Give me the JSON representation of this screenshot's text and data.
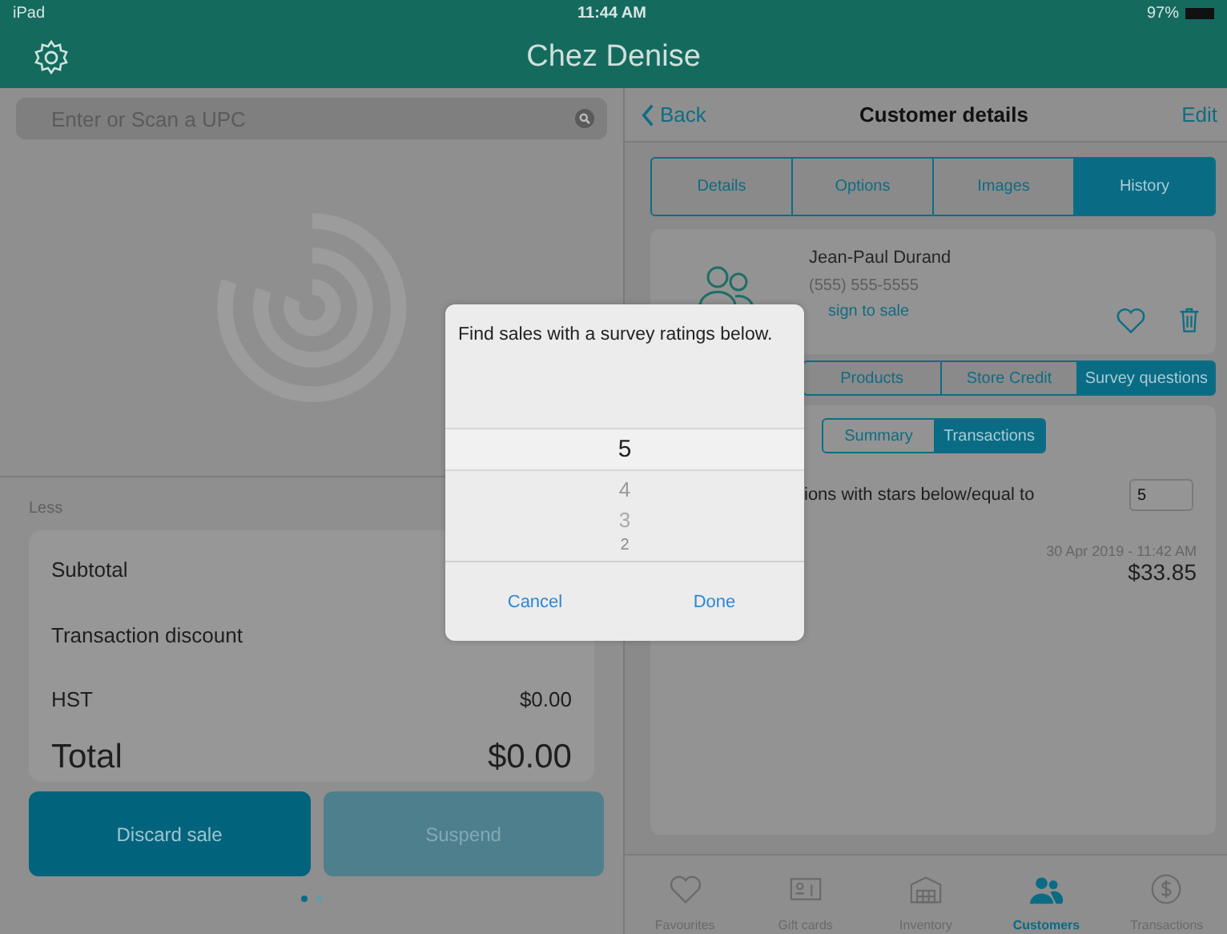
{
  "status_bar": {
    "carrier": "iPad",
    "time": "11:44 AM",
    "battery": "97%"
  },
  "header": {
    "title": "Chez Denise"
  },
  "search": {
    "placeholder": "Enter or Scan a UPC"
  },
  "cart": {
    "section_label": "Less",
    "lines": [
      {
        "label": "Subtotal"
      },
      {
        "label": "Transaction discount"
      },
      {
        "label": "HST",
        "value": "$0.00"
      }
    ],
    "total_label": "Total",
    "total_value": "$0.00"
  },
  "actions": [
    {
      "label": "Discard sale",
      "disabled": false
    },
    {
      "label": "Suspend",
      "disabled": true
    }
  ],
  "page_dots": [
    {
      "selected": true
    },
    {
      "selected": false
    }
  ],
  "nav": {
    "back": "Back",
    "title": "Customer details",
    "edit": "Edit"
  },
  "tabs": [
    {
      "label": "Details",
      "selected": false
    },
    {
      "label": "Options",
      "selected": false
    },
    {
      "label": "Images",
      "selected": false
    },
    {
      "label": "History",
      "selected": true
    }
  ],
  "customer": {
    "name": "Jean-Paul Durand",
    "phone": "(555) 555-5555",
    "assign": "sign to sale"
  },
  "sub_tabs": [
    {
      "label": "Products",
      "selected": false
    },
    {
      "label": "Store Credit",
      "selected": false
    },
    {
      "label": "Survey questions",
      "selected": true
    }
  ],
  "view_toggle": [
    {
      "label": "Summary",
      "selected": false
    },
    {
      "label": "Transactions",
      "selected": true
    }
  ],
  "filter": {
    "label": "ions with stars below/equal to",
    "value": "5"
  },
  "transactions": [
    {
      "date": "30 Apr 2019 - 11:42 AM",
      "amount": "$33.85"
    }
  ],
  "tab_bar": [
    {
      "label": "Favourites",
      "selected": false
    },
    {
      "label": "Gift cards",
      "selected": false
    },
    {
      "label": "Inventory",
      "selected": false
    },
    {
      "label": "Customers",
      "selected": true
    },
    {
      "label": "Transactions",
      "selected": false
    }
  ],
  "dialog": {
    "message": "Find sales with a survey ratings below.",
    "picker": [
      {
        "label": "5",
        "selected": true
      },
      {
        "label": "4",
        "selected": false
      },
      {
        "label": "3",
        "selected": false
      },
      {
        "label": "2",
        "selected": false
      }
    ],
    "buttons": [
      "Cancel",
      "Done"
    ]
  }
}
